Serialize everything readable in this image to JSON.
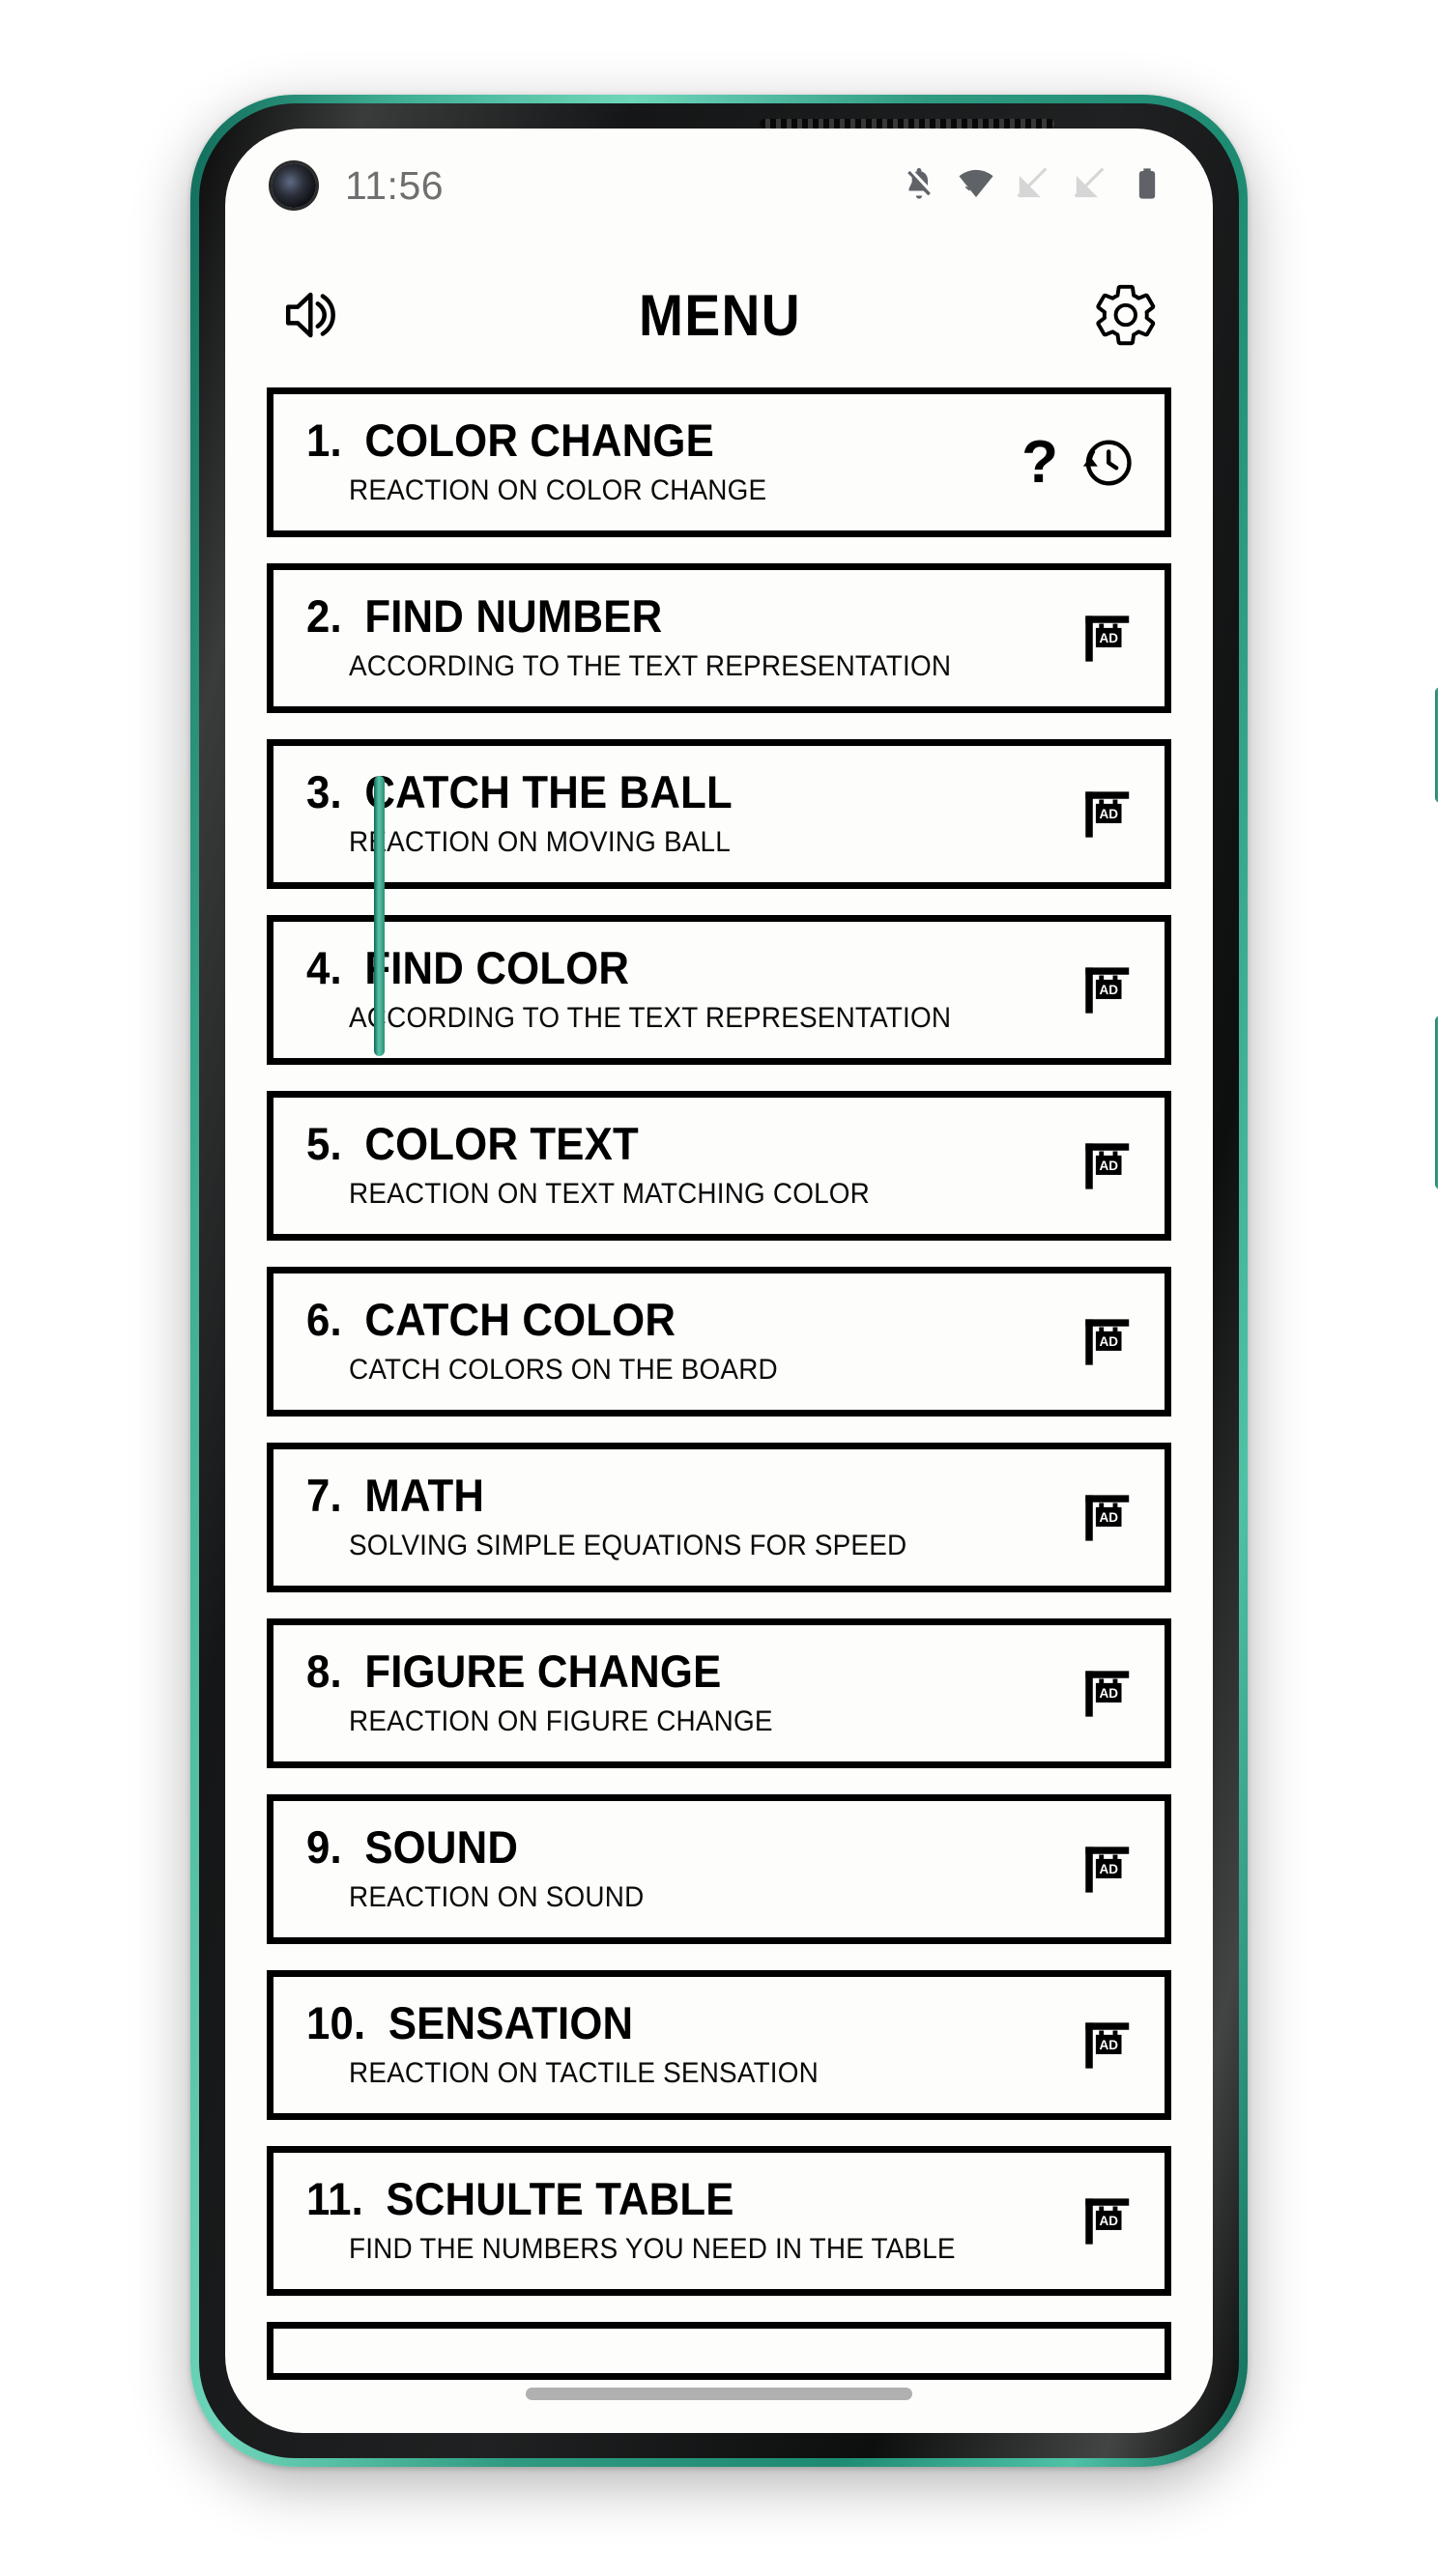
{
  "status_bar": {
    "time": "11:56",
    "icons": [
      {
        "name": "notifications-off-icon",
        "label": "notifications off"
      },
      {
        "name": "wifi-icon",
        "label": "wifi"
      },
      {
        "name": "signal-off-icon-1",
        "label": "sim 1 no signal"
      },
      {
        "name": "signal-off-icon-2",
        "label": "sim 2 no signal"
      },
      {
        "name": "battery-icon",
        "label": "battery full"
      }
    ]
  },
  "header": {
    "title": "MENU",
    "sound_icon": "speaker-icon",
    "settings_icon": "gear-icon"
  },
  "colors": {
    "frame_green": "#2f9a80",
    "screen_bg": "#fdfdfb",
    "border": "#000000",
    "text": "#000000",
    "status_text": "#6f6f6f",
    "home_indicator": "#b0b0b0"
  },
  "menu": {
    "items": [
      {
        "number": "1.",
        "title": "COLOR CHANGE",
        "subtitle": "REACTION ON COLOR CHANGE",
        "actions": [
          "help-icon",
          "history-icon"
        ]
      },
      {
        "number": "2.",
        "title": "FIND NUMBER",
        "subtitle": "ACCORDING TO THE TEXT REPRESENTATION",
        "actions": [
          "ad-icon"
        ]
      },
      {
        "number": "3.",
        "title": "CATCH THE BALL",
        "subtitle": "REACTION ON MOVING BALL",
        "actions": [
          "ad-icon"
        ]
      },
      {
        "number": "4.",
        "title": "FIND COLOR",
        "subtitle": "ACCORDING TO THE TEXT REPRESENTATION",
        "actions": [
          "ad-icon"
        ]
      },
      {
        "number": "5.",
        "title": "COLOR TEXT",
        "subtitle": "REACTION ON TEXT MATCHING COLOR",
        "actions": [
          "ad-icon"
        ]
      },
      {
        "number": "6.",
        "title": "CATCH COLOR",
        "subtitle": "CATCH COLORS ON THE BOARD",
        "actions": [
          "ad-icon"
        ]
      },
      {
        "number": "7.",
        "title": "MATH",
        "subtitle": "SOLVING SIMPLE EQUATIONS FOR SPEED",
        "actions": [
          "ad-icon"
        ]
      },
      {
        "number": "8.",
        "title": "FIGURE CHANGE",
        "subtitle": "REACTION ON FIGURE CHANGE",
        "actions": [
          "ad-icon"
        ]
      },
      {
        "number": "9.",
        "title": "SOUND",
        "subtitle": "REACTION ON SOUND",
        "actions": [
          "ad-icon"
        ]
      },
      {
        "number": "10.",
        "title": "SENSATION",
        "subtitle": "REACTION ON TACTILE SENSATION",
        "actions": [
          "ad-icon"
        ]
      },
      {
        "number": "11.",
        "title": "SCHULTE TABLE",
        "subtitle": "FIND THE NUMBERS YOU NEED IN THE TABLE",
        "actions": [
          "ad-icon"
        ]
      }
    ],
    "ad_badge_label": "AD",
    "help_label": "?"
  }
}
